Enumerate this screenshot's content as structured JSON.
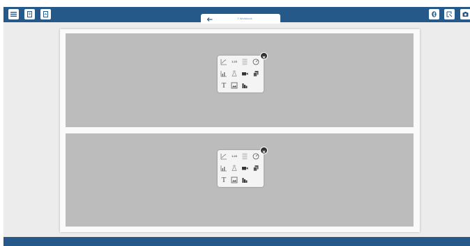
{
  "app": {
    "colors": {
      "bar": "#24598a",
      "panel": "#bcbcbc",
      "picker": "#f4f4f4"
    }
  },
  "toolbar_left": {
    "items": [
      {
        "icon": "menu-icon"
      },
      {
        "icon": "file-icon"
      },
      {
        "icon": "export-icon"
      }
    ]
  },
  "toolbar_right": {
    "items": [
      {
        "icon": "bluetooth-icon"
      },
      {
        "icon": "cursor-icon"
      },
      {
        "icon": "camera-icon"
      }
    ]
  },
  "page_tab": {
    "title": "2 Workbook",
    "back_icon": "back-arrow-icon"
  },
  "panels": [
    {
      "picker": {
        "number_label": "1.23",
        "text_label": "T",
        "close_icon": "close-icon",
        "items": [
          "line-graph-icon",
          "number-display-icon",
          "table-icon",
          "gauge-icon",
          "bar-chart-icon",
          "flask-icon",
          "video-icon",
          "copy-icon",
          "text-icon",
          "image-icon",
          "histogram-icon"
        ]
      }
    },
    {
      "picker": {
        "number_label": "1.23",
        "text_label": "T",
        "close_icon": "close-icon",
        "items": [
          "line-graph-icon",
          "number-display-icon",
          "table-icon",
          "gauge-icon",
          "bar-chart-icon",
          "flask-icon",
          "video-icon",
          "copy-icon",
          "text-icon",
          "image-icon",
          "histogram-icon"
        ]
      }
    }
  ]
}
